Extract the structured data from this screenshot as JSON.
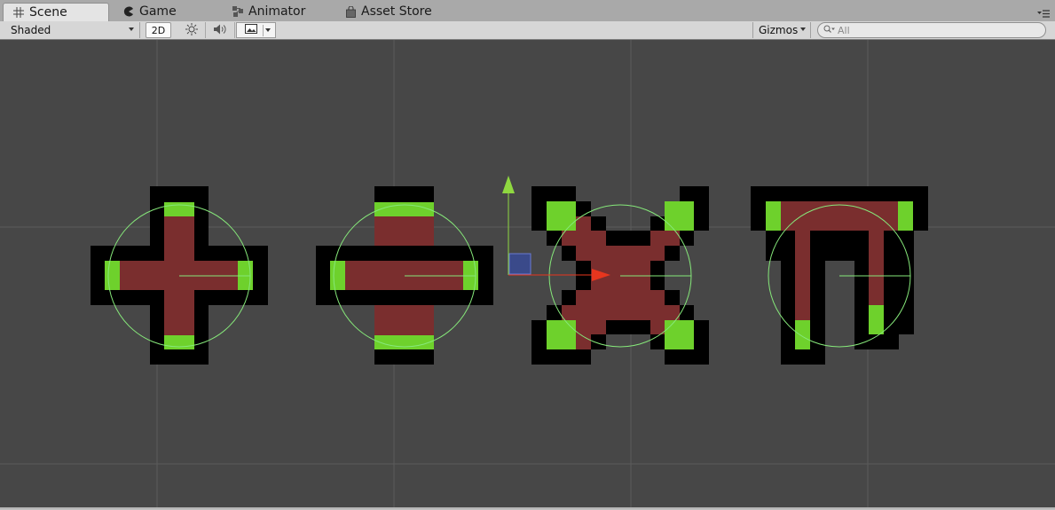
{
  "tabs": [
    {
      "label": "Scene",
      "icon": "grid-icon",
      "active": true
    },
    {
      "label": "Game",
      "icon": "pacman-icon",
      "active": false
    },
    {
      "label": "Animator",
      "icon": "animator-icon",
      "active": false
    },
    {
      "label": "Asset Store",
      "icon": "store-bag-icon",
      "active": false
    }
  ],
  "toolbar": {
    "shading_mode": "Shaded",
    "mode_2d_label": "2D",
    "lighting_icon": "sun-icon",
    "audio_icon": "speaker-icon",
    "effects_icon": "image-icon",
    "gizmos_label": "Gizmos",
    "search_placeholder": "All"
  },
  "scene": {
    "sprites": [
      "plus-sprite",
      "divide-sprite",
      "multiply-sprite",
      "pi-sprite"
    ],
    "colors": {
      "background": "#474747",
      "grid_line": "#5a5a5a",
      "sprite_fill": "#7a2e2e",
      "sprite_outline": "#000000",
      "sprite_caps": "#6ed12c",
      "collider": "#86e87a",
      "handle_y": "#8fd840",
      "handle_x": "#e8361e",
      "handle_plane": "#3a4a8a"
    }
  }
}
